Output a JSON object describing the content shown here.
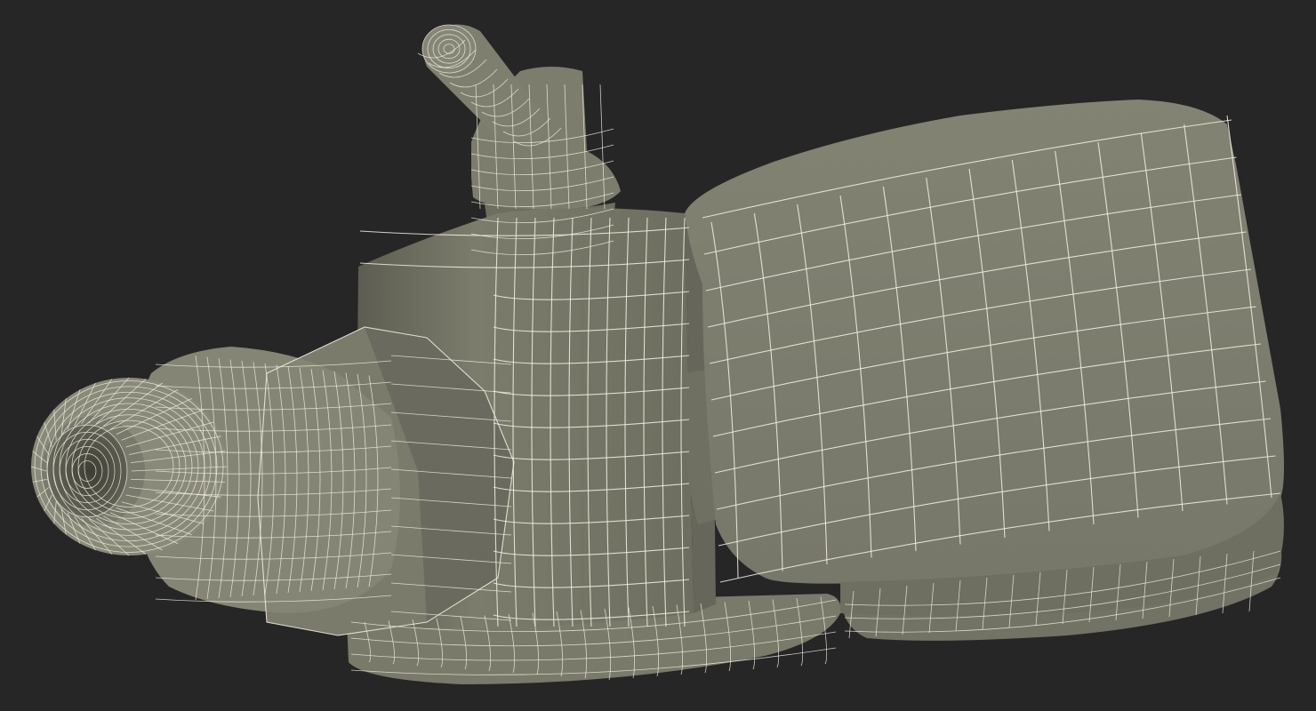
{
  "scene": {
    "subject": "wireframe-3d-model",
    "colors": {
      "background": "#262626",
      "surface": "#7b7b6c",
      "surface_light": "#8a8a7a",
      "surface_shadow": "#55554a",
      "wire": "#f3f0e2"
    }
  }
}
